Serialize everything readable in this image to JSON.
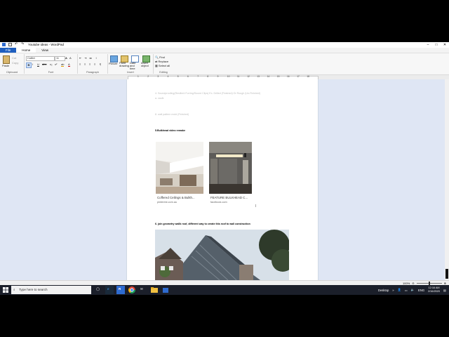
{
  "window": {
    "title": "Youtube ideas - WordPad",
    "tabs": [
      "File",
      "Home",
      "View"
    ],
    "active_tab": "Home"
  },
  "ribbon": {
    "groups": [
      {
        "label": "Clipboard",
        "items": [
          "Paste",
          "Cut",
          "Copy"
        ]
      },
      {
        "label": "Font",
        "font_name": "Calibri",
        "font_size": "11"
      },
      {
        "label": "Paragraph"
      },
      {
        "label": "Insert",
        "items": [
          "Picture",
          "Paint drawing",
          "Date and time",
          "Insert object"
        ]
      },
      {
        "label": "Editing",
        "items": [
          "Find",
          "Replace",
          "Select all"
        ]
      }
    ]
  },
  "ruler": {
    "numbers": [
      "1",
      "2",
      "3",
      "4",
      "5",
      "6",
      "7",
      "8",
      "9",
      "10",
      "11",
      "12",
      "13",
      "14",
      "15",
      "16",
      "17",
      "18"
    ]
  },
  "document": {
    "faint_line_1": "4. Soundproofing(Resilient Furring/Sound Clips) Ex. Drilled (Finished) Or Rough (Un-Finished)",
    "faint_line_2": "a. caulk",
    "faint_line_3": "8. wall pattern mold (Finished)",
    "heading_5": "5.Bulkhead video remake",
    "card1": {
      "caption": "Coffered Ceilings & Bulkh...",
      "source": "pinterest.com.au"
    },
    "card2": {
      "caption": "FEATURE BULKHEAD C...",
      "source": "facebook.com"
    },
    "heading_6": "6. join geometry  wallk roof, different way to create this roof to wall construction"
  },
  "status": {
    "zoom": "100%"
  },
  "taskbar": {
    "search_placeholder": "Type here to search",
    "desktop_label": "Desktop",
    "lang": "ENG",
    "time": "12:16 AM",
    "date": "2/16/2020"
  }
}
